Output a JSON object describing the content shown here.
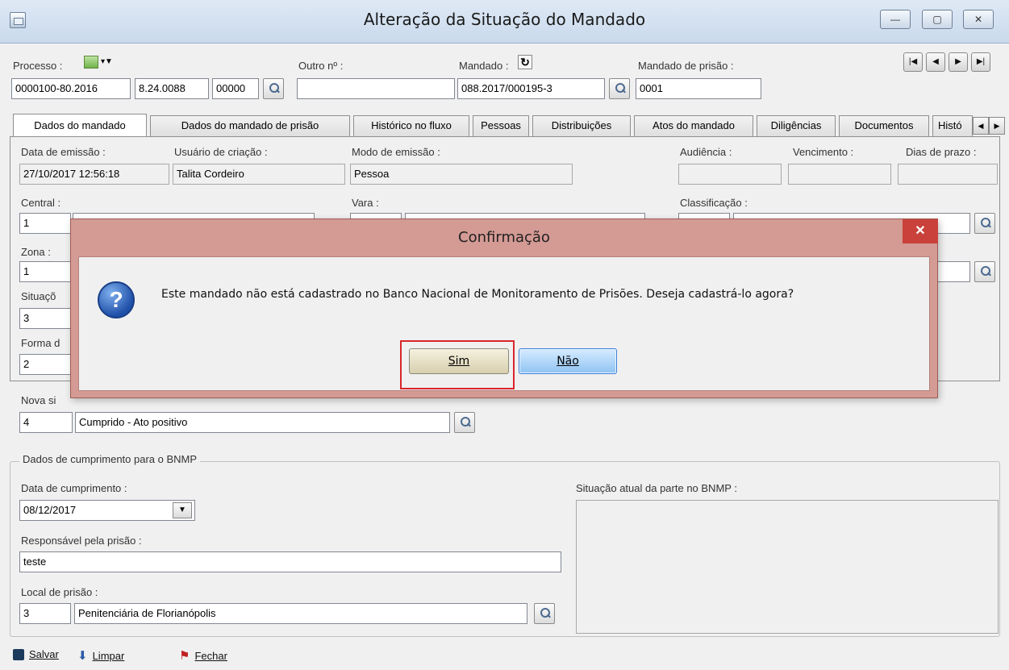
{
  "window": {
    "title": "Alteração da Situação do Mandado",
    "controls": {
      "minimize": "—",
      "maximize": "▢",
      "close": "✕"
    }
  },
  "header": {
    "processo_label": "Processo :",
    "processo_parts": [
      "0000100-80.2016",
      "8.24.0088",
      "00000"
    ],
    "outro_label": "Outro nº :",
    "outro_value": "",
    "mandado_label": "Mandado :",
    "mandado_value": "088.2017/000195-3",
    "mandado_prisao_label": "Mandado de prisão :",
    "mandado_prisao_value": "0001",
    "nav": [
      "|◀",
      "◀",
      "▶",
      "▶|"
    ]
  },
  "tabs": [
    "Dados do mandado",
    "Dados do mandado de prisão",
    "Histórico no fluxo",
    "Pessoas",
    "Distribuições",
    "Atos do mandado",
    "Diligências",
    "Documentos",
    "Histó"
  ],
  "tab_panel": {
    "data_emissao_label": "Data de emissão :",
    "data_emissao": "27/10/2017 12:56:18",
    "usuario_label": "Usuário de criação :",
    "usuario": "Talita Cordeiro",
    "modo_label": "Modo de emissão :",
    "modo": "Pessoa",
    "audiencia_label": "Audiência :",
    "vencimento_label": "Vencimento :",
    "dias_label": "Dias de prazo :",
    "central_label": "Central :",
    "central_code": "1",
    "vara_label": "Vara :",
    "classificacao_label": "Classificação :",
    "zona_label": "Zona :",
    "zona_code": "1",
    "situacao_label": "Situaçõ",
    "situacao_code": "3",
    "forma_label": "Forma d",
    "forma_code": "2"
  },
  "nova_situacao": {
    "label": "Nova si",
    "code": "4",
    "description": "Cumprido - Ato positivo"
  },
  "bnmp": {
    "group_title": "Dados de cumprimento para o BNMP",
    "data_cumprimento_label": "Data de cumprimento :",
    "data_cumprimento": "08/12/2017",
    "responsavel_label": "Responsável pela prisão :",
    "responsavel": "teste",
    "local_label": "Local de prisão :",
    "local_code": "3",
    "local_desc": "Penitenciária de Florianópolis",
    "situacao_atual_label": "Situação atual da parte no BNMP :"
  },
  "toolbar": {
    "salvar": "Salvar",
    "limpar": "Limpar",
    "fechar": "Fechar"
  },
  "dialog": {
    "title": "Confirmação",
    "close": "✕",
    "message": "Este mandado não está cadastrado no Banco Nacional de Monitoramento de Prisões. Deseja cadastrá-lo agora?",
    "icon": "?",
    "yes": "Sim",
    "no": "Não"
  },
  "colors": {
    "dialog_frame": "#d49a94",
    "highlight": "#d9262b",
    "title_gradient": "#c9d9ec"
  }
}
